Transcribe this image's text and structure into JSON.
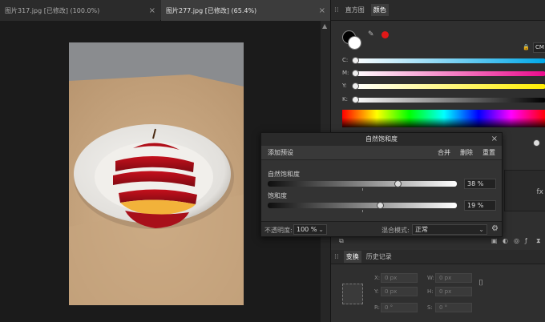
{
  "tabs": [
    {
      "label": "图片317.jpg [已修改] (100.0%)",
      "close": "×"
    },
    {
      "label": "图片277.jpg [已修改] (65.4%)",
      "close": "×"
    }
  ],
  "panel": {
    "tabs": [
      "直方图",
      "颜色"
    ],
    "cmyk_button": "CM",
    "channels": [
      "C:",
      "M:",
      "Y:",
      "K:"
    ],
    "transform_tabs": [
      "变换",
      "历史记录"
    ],
    "transform_fields": {
      "x_label": "X:",
      "x_value": "0 px",
      "y_label": "Y:",
      "y_value": "0 px",
      "w_label": "W:",
      "w_value": "0 px",
      "h_label": "H:",
      "h_value": "0 px",
      "r_label": "R:",
      "r_value": "0 °",
      "s_label": "S:",
      "s_value": "0 °"
    }
  },
  "dialog": {
    "title": "自然饱和度",
    "add_preset": "添加预设",
    "actions": [
      "合并",
      "删除",
      "重置"
    ],
    "close": "×",
    "sliders": [
      {
        "label": "自然饱和度",
        "value_text": "38 %",
        "value": 38
      },
      {
        "label": "饱和度",
        "value_text": "19 %",
        "value": 19
      }
    ],
    "opacity_label": "不透明度:",
    "opacity_value": "100 %",
    "blend_label": "混合模式:",
    "blend_value": "正常"
  },
  "colors": {
    "accent_red": "#e01818",
    "primary_fill": "#ffffff",
    "secondary_fill": "#000000"
  }
}
